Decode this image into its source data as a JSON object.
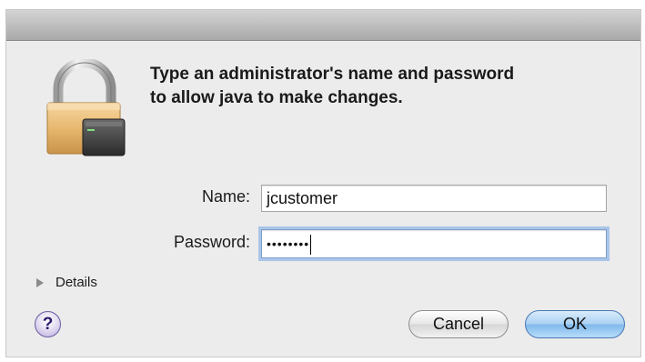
{
  "dialog": {
    "message_line1": "Type an administrator's name and password",
    "message_line2": "to allow java to make changes."
  },
  "form": {
    "name_label": "Name:",
    "name_value": "jcustomer",
    "password_label": "Password:",
    "password_masked": "••••••••"
  },
  "details": {
    "label": "Details"
  },
  "help": {
    "glyph": "?"
  },
  "buttons": {
    "cancel_label": "Cancel",
    "ok_label": "OK"
  },
  "icons": {
    "lock": "padlock-icon",
    "help": "help-icon",
    "details": "disclosure-triangle-icon"
  },
  "colors": {
    "dialog_bg": "#ececec",
    "focus_ring": "#a9c5e8",
    "default_button": "#7fb8ea",
    "lock_body": "#e8b86f"
  }
}
